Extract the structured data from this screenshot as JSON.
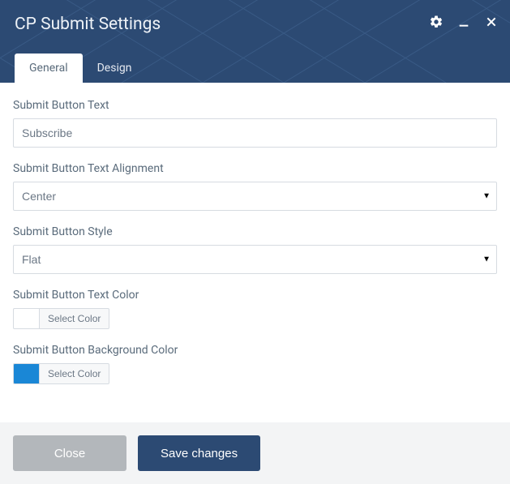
{
  "header": {
    "title": "CP Submit Settings"
  },
  "tabs": [
    {
      "label": "General",
      "active": true
    },
    {
      "label": "Design",
      "active": false
    }
  ],
  "fields": {
    "submit_text": {
      "label": "Submit Button Text",
      "value": "Subscribe"
    },
    "alignment": {
      "label": "Submit Button Text Alignment",
      "value": "Center"
    },
    "style": {
      "label": "Submit Button Style",
      "value": "Flat"
    },
    "text_color": {
      "label": "Submit Button Text Color",
      "button_label": "Select Color",
      "swatch": "#ffffff"
    },
    "bg_color": {
      "label": "Submit Button Background Color",
      "button_label": "Select Color",
      "swatch": "#1a87d6"
    }
  },
  "footer": {
    "close_label": "Close",
    "save_label": "Save changes"
  }
}
